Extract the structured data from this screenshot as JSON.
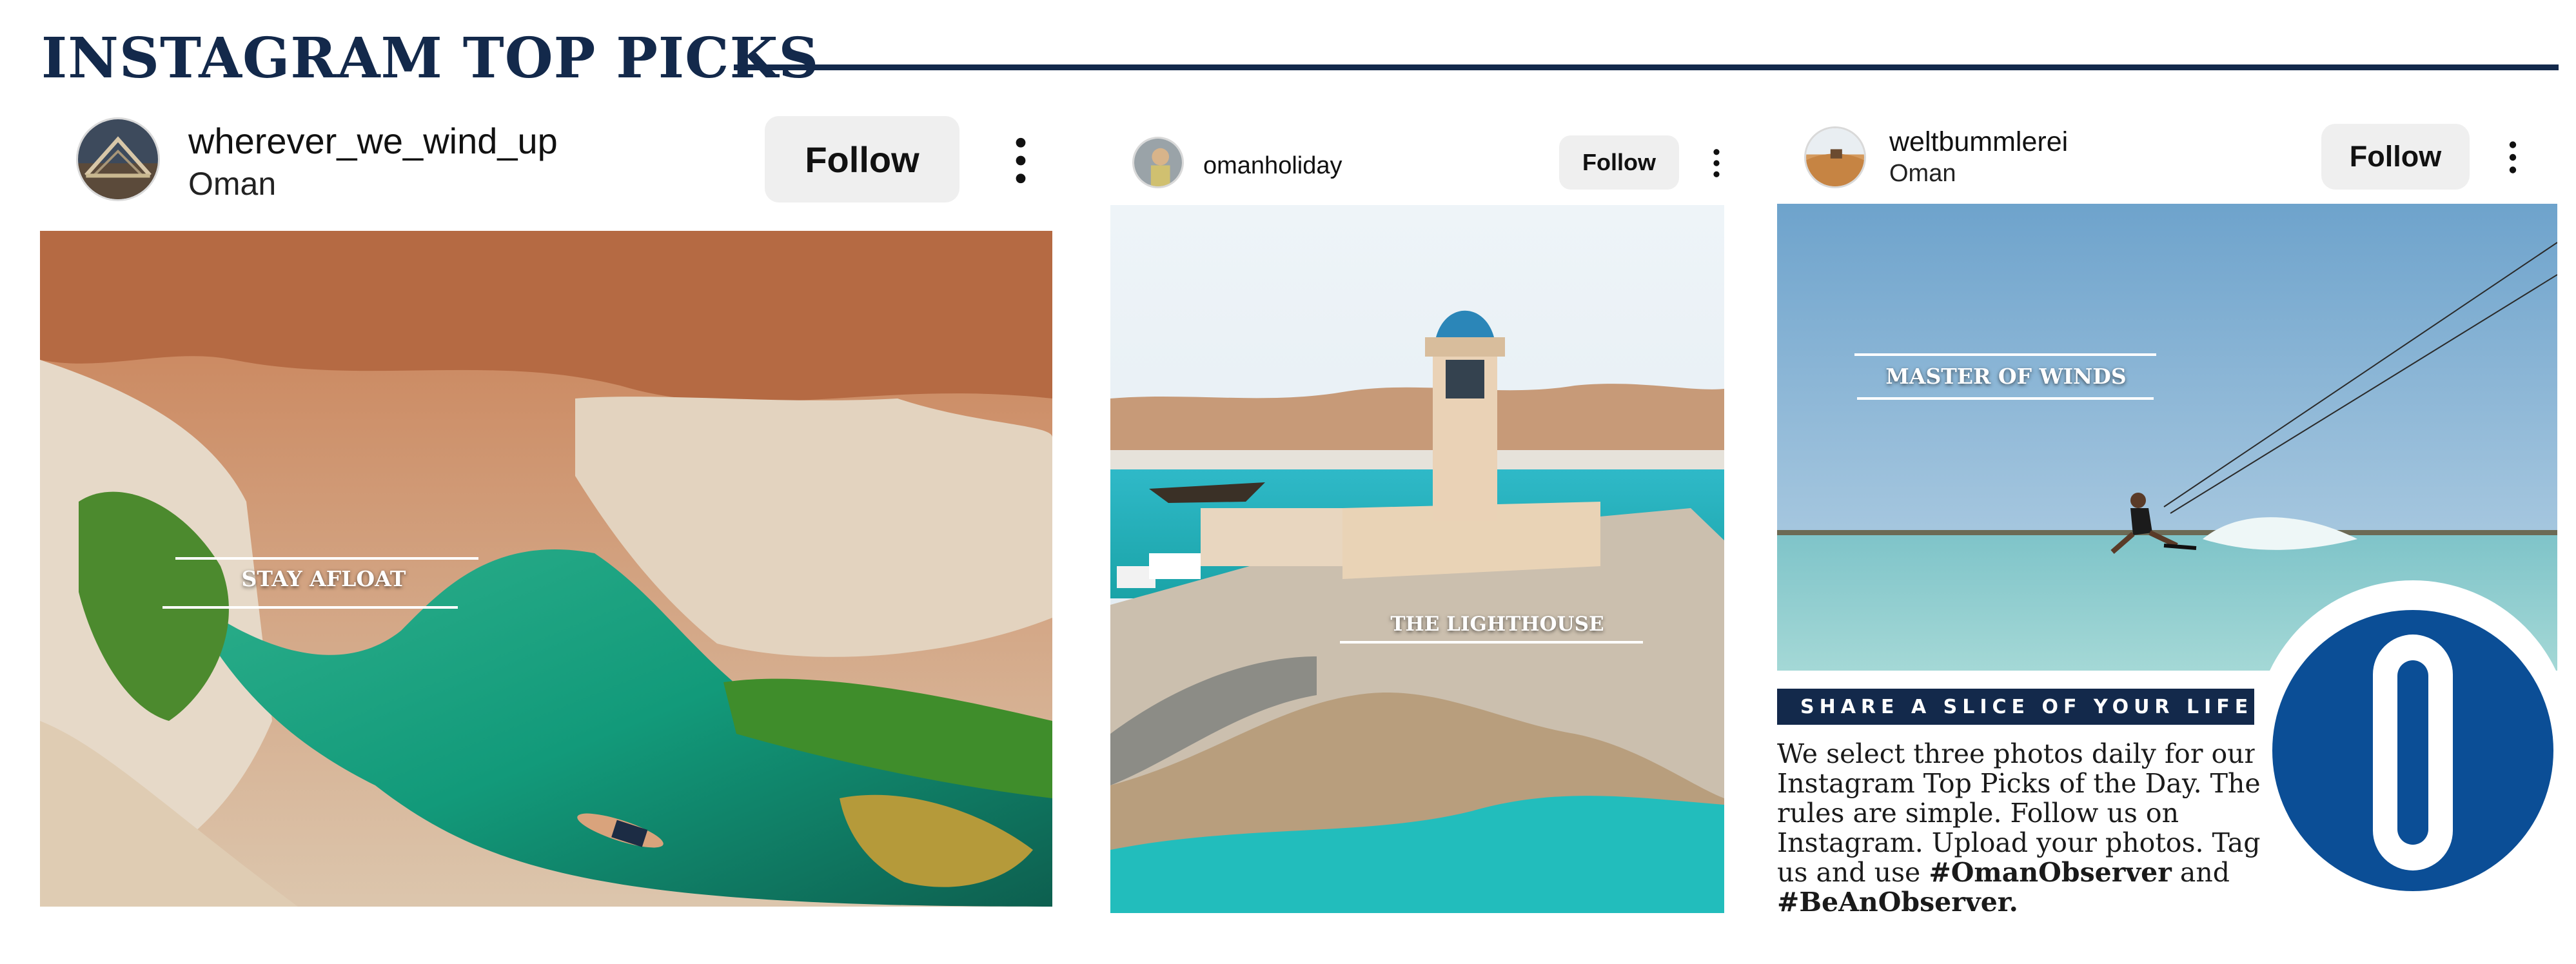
{
  "page": {
    "title": "INSTAGRAM TOP PICKS",
    "accent_color": "#13294b"
  },
  "posts": [
    {
      "username": "wherever_we_wind_up",
      "location": "Oman",
      "follow_label": "Follow",
      "caption": "STAY AFLOAT",
      "avatar_icon": "bridge-avatar",
      "more_icon": "more-vertical-icon"
    },
    {
      "username": "omanholiday",
      "location": "",
      "follow_label": "Follow",
      "caption": "THE LIGHTHOUSE",
      "avatar_icon": "person-avatar",
      "more_icon": "more-vertical-icon"
    },
    {
      "username": "weltbummlerei",
      "location": "Oman",
      "follow_label": "Follow",
      "caption": "MASTER OF WINDS",
      "avatar_icon": "desert-avatar",
      "more_icon": "more-vertical-icon"
    }
  ],
  "share": {
    "banner": "SHARE A SLICE OF YOUR LIFE",
    "text_part1": "We select three photos daily for our Instagram Top Picks of the Day. The rules are simple. Follow us on Instagram. Upload your photos. Tag us and use ",
    "hashtag1": "#OmanObserver",
    "text_and": " and ",
    "hashtag2": "#BeAnObserver.",
    "logo_icon": "observer-o-logo"
  }
}
